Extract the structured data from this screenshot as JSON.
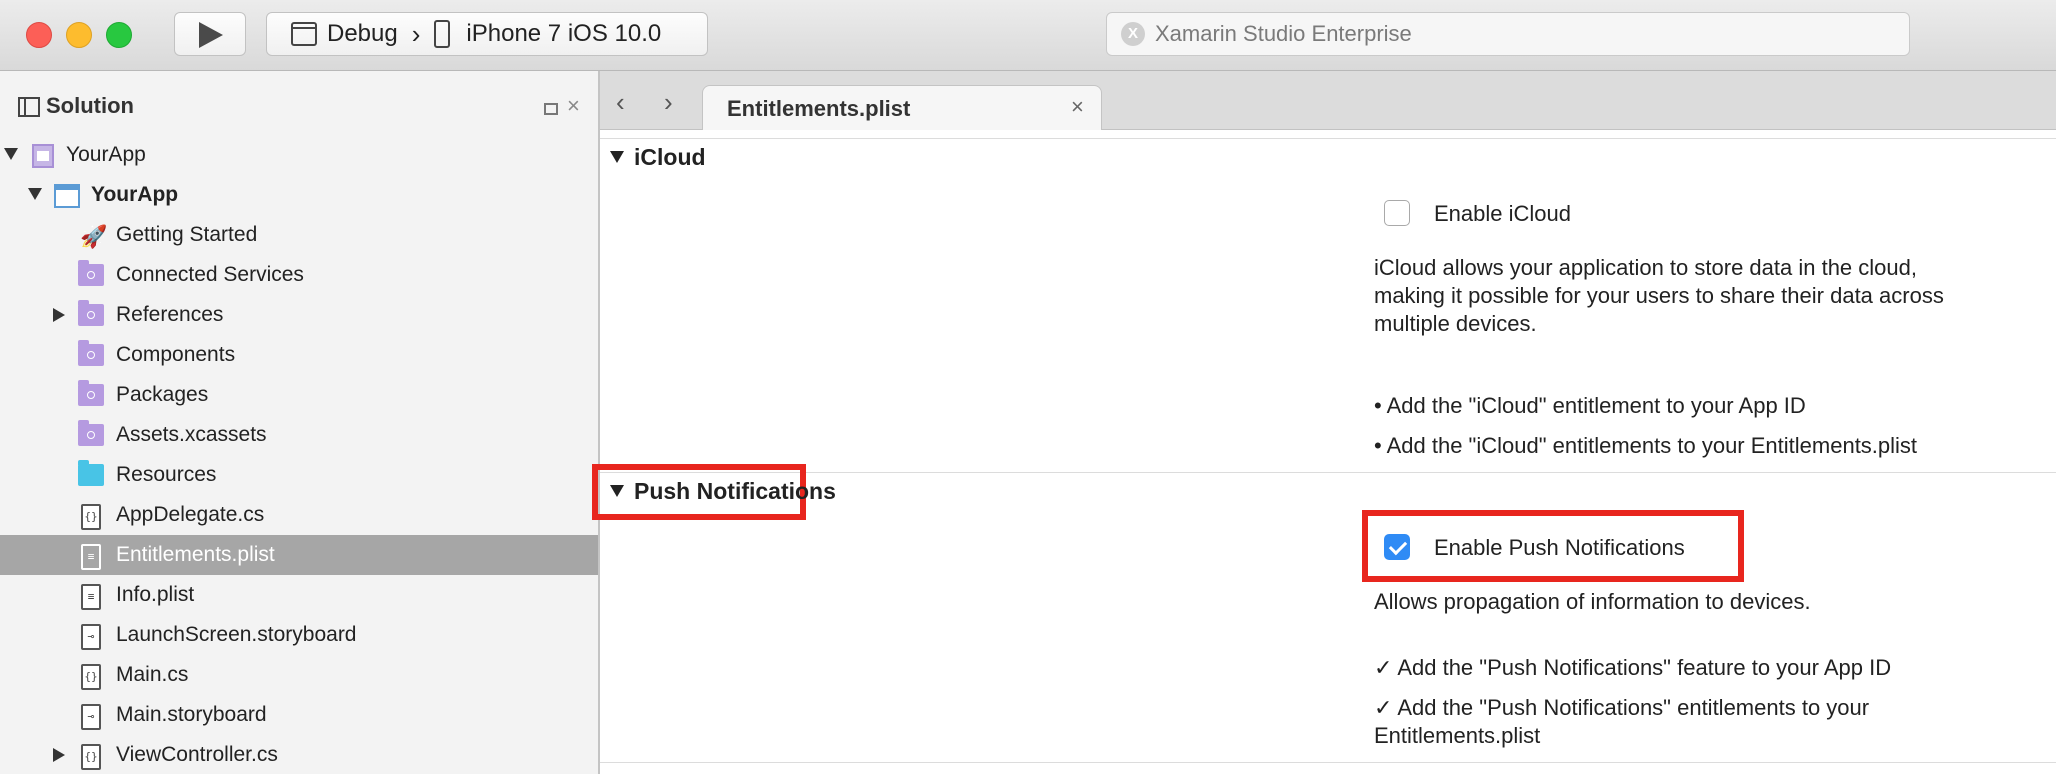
{
  "toolbar": {
    "configuration": "Debug",
    "device": "iPhone 7 iOS 10.0",
    "status": "Xamarin Studio Enterprise",
    "logo_letter": "X"
  },
  "sidebar": {
    "title": "Solution",
    "close_glyph": "×",
    "items": [
      {
        "label": "YourApp",
        "icon": "solution-icon"
      },
      {
        "label": "YourApp",
        "icon": "project-icon"
      },
      {
        "label": "Getting Started",
        "icon": "rocket-icon"
      },
      {
        "label": "Connected Services",
        "icon": "folder-icon"
      },
      {
        "label": "References",
        "icon": "folder-icon"
      },
      {
        "label": "Components",
        "icon": "folder-icon"
      },
      {
        "label": "Packages",
        "icon": "folder-icon"
      },
      {
        "label": "Assets.xcassets",
        "icon": "folder-icon"
      },
      {
        "label": "Resources",
        "icon": "folder-icon"
      },
      {
        "label": "AppDelegate.cs",
        "icon": "cs-file-icon"
      },
      {
        "label": "Entitlements.plist",
        "icon": "plist-file-icon"
      },
      {
        "label": "Info.plist",
        "icon": "plist-file-icon"
      },
      {
        "label": "LaunchScreen.storyboard",
        "icon": "storyboard-file-icon"
      },
      {
        "label": "Main.cs",
        "icon": "cs-file-icon"
      },
      {
        "label": "Main.storyboard",
        "icon": "storyboard-file-icon"
      },
      {
        "label": "ViewController.cs",
        "icon": "cs-file-icon"
      }
    ],
    "selected_item": "Entitlements.plist"
  },
  "tabs": {
    "back_glyph": "‹",
    "forward_glyph": "›",
    "active": {
      "label": "Entitlements.plist",
      "close_glyph": "×"
    }
  },
  "editor": {
    "icloud": {
      "header": "iCloud",
      "checkbox_label": "Enable iCloud",
      "checked": false,
      "description_lines": [
        "iCloud allows your application to store data in the cloud,",
        "making it possible for your users to share their data across",
        "multiple devices."
      ],
      "steps": [
        "• Add the \"iCloud\" entitlement to your App ID",
        "• Add the \"iCloud\" entitlements to your Entitlements.plist"
      ]
    },
    "push": {
      "header": "Push Notifications",
      "checkbox_label": "Enable Push Notifications",
      "checked": true,
      "description": "Allows propagation of information to devices.",
      "steps": [
        "✓ Add the \"Push Notifications\" feature to your App ID",
        "✓ Add the \"Push Notifications\" entitlements to your",
        "Entitlements.plist"
      ]
    },
    "highlight_color": "#e8261e",
    "checkbox_color": "#2f8bf5"
  }
}
